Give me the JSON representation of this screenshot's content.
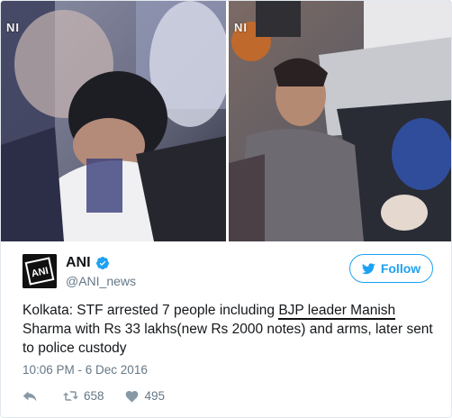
{
  "media": {
    "watermark_left": "NI",
    "watermark_right": "NI"
  },
  "author": {
    "display_name": "ANI",
    "handle": "@ANI_news",
    "avatar_icon": "ani-logo-icon",
    "verified_icon": "verified-badge-icon",
    "follow_label": "Follow",
    "follow_icon": "bird-icon"
  },
  "tweet": {
    "text_before": "Kolkata: STF arrested 7 people including ",
    "text_highlight": "BJP leader Manish",
    "text_after": " Sharma with Rs 33 lakhs(new Rs 2000 notes) and arms, later sent to police custody",
    "timestamp": "10:06 PM - 6 Dec 2016"
  },
  "actions": {
    "reply_icon": "reply-icon",
    "retweet_icon": "retweet-icon",
    "retweet_count": "658",
    "like_icon": "heart-icon",
    "like_count": "495"
  },
  "colors": {
    "accent": "#1da1f2",
    "muted": "#657786",
    "text": "#14171a"
  }
}
